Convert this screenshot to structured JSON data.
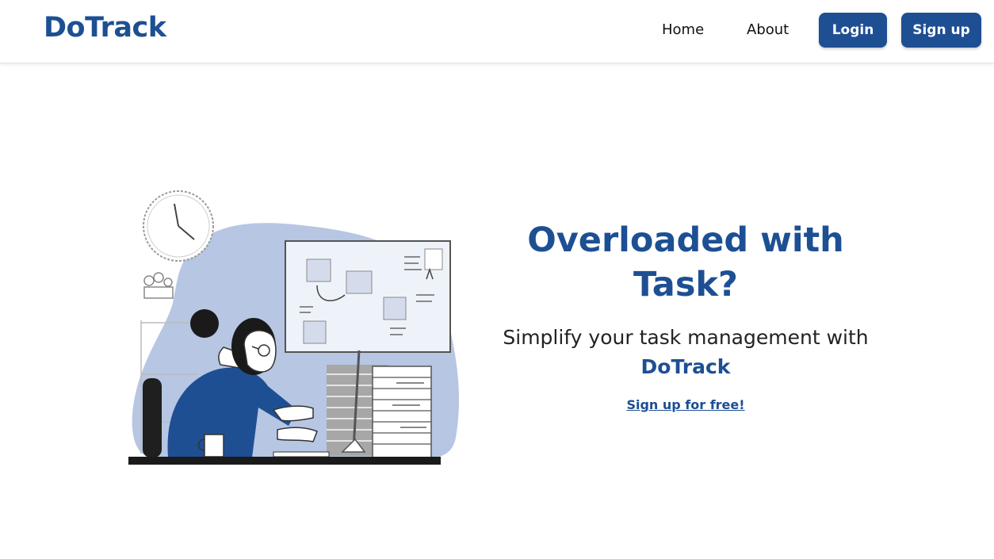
{
  "brand": {
    "name": "DoTrack"
  },
  "nav": {
    "home": "Home",
    "about": "About",
    "login": "Login",
    "signup": "Sign up"
  },
  "hero": {
    "headline": "Overloaded with Task?",
    "subline_prefix": "Simplify your task management with",
    "subline_brand": "DoTrack",
    "cta": "Sign up for free!"
  },
  "colors": {
    "brand_blue": "#1d4f93",
    "illustration_blob": "#b6c6e3",
    "text_dark": "#222222",
    "background": "#ffffff"
  },
  "illustration": {
    "icons": [
      "wall-clock-icon",
      "task-board-icon",
      "woman-at-desk-icon",
      "coffee-mug-icon",
      "paper-stack-icon"
    ]
  }
}
